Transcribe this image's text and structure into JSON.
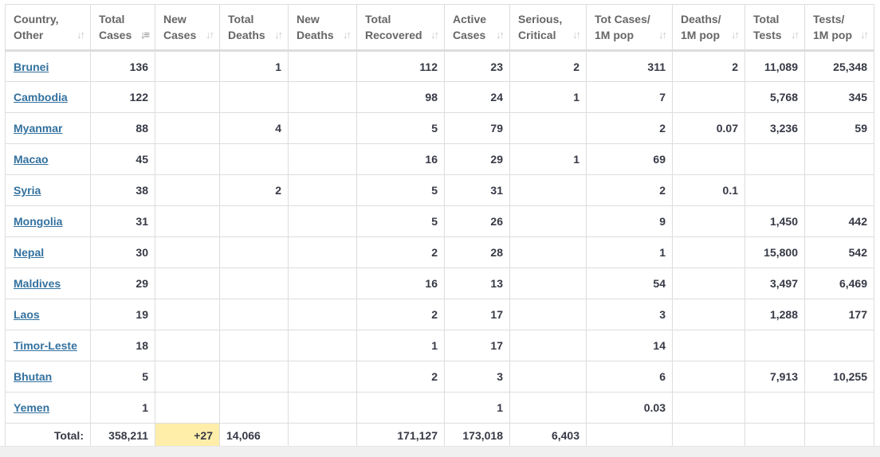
{
  "table": {
    "headers": [
      {
        "label": "Country,\nOther",
        "key": "country",
        "sort": "inactive"
      },
      {
        "label": "Total\nCases",
        "key": "total_cases",
        "sort": "active"
      },
      {
        "label": "New\nCases",
        "key": "new_cases",
        "sort": "inactive"
      },
      {
        "label": "Total\nDeaths",
        "key": "total_deaths",
        "sort": "inactive"
      },
      {
        "label": "New\nDeaths",
        "key": "new_deaths",
        "sort": "inactive"
      },
      {
        "label": "Total\nRecovered",
        "key": "total_recovered",
        "sort": "inactive"
      },
      {
        "label": "Active\nCases",
        "key": "active_cases",
        "sort": "inactive"
      },
      {
        "label": "Serious,\nCritical",
        "key": "serious",
        "sort": "inactive"
      },
      {
        "label": "Tot Cases/\n1M pop",
        "key": "cases_per_m",
        "sort": "inactive"
      },
      {
        "label": "Deaths/\n1M pop",
        "key": "deaths_per_m",
        "sort": "inactive"
      },
      {
        "label": "Total\nTests",
        "key": "total_tests",
        "sort": "inactive"
      },
      {
        "label": "Tests/\n1M pop",
        "key": "tests_per_m",
        "sort": "inactive"
      }
    ],
    "sort_icon_inactive": "↓↑",
    "sort_icon_active": "↓≡",
    "rows": [
      [
        "Brunei",
        "136",
        "",
        "1",
        "",
        "112",
        "23",
        "2",
        "311",
        "2",
        "11,089",
        "25,348"
      ],
      [
        "Cambodia",
        "122",
        "",
        "",
        "",
        "98",
        "24",
        "1",
        "7",
        "",
        "5,768",
        "345"
      ],
      [
        "Myanmar",
        "88",
        "",
        "4",
        "",
        "5",
        "79",
        "",
        "2",
        "0.07",
        "3,236",
        "59"
      ],
      [
        "Macao",
        "45",
        "",
        "",
        "",
        "16",
        "29",
        "1",
        "69",
        "",
        "",
        ""
      ],
      [
        "Syria",
        "38",
        "",
        "2",
        "",
        "5",
        "31",
        "",
        "2",
        "0.1",
        "",
        ""
      ],
      [
        "Mongolia",
        "31",
        "",
        "",
        "",
        "5",
        "26",
        "",
        "9",
        "",
        "1,450",
        "442"
      ],
      [
        "Nepal",
        "30",
        "",
        "",
        "",
        "2",
        "28",
        "",
        "1",
        "",
        "15,800",
        "542"
      ],
      [
        "Maldives",
        "29",
        "",
        "",
        "",
        "16",
        "13",
        "",
        "54",
        "",
        "3,497",
        "6,469"
      ],
      [
        "Laos",
        "19",
        "",
        "",
        "",
        "2",
        "17",
        "",
        "3",
        "",
        "1,288",
        "177"
      ],
      [
        "Timor-Leste",
        "18",
        "",
        "",
        "",
        "1",
        "17",
        "",
        "14",
        "",
        "",
        ""
      ],
      [
        "Bhutan",
        "5",
        "",
        "",
        "",
        "2",
        "3",
        "",
        "6",
        "",
        "7,913",
        "10,255"
      ],
      [
        "Yemen",
        "1",
        "",
        "",
        "",
        "",
        "1",
        "",
        "0.03",
        "",
        "",
        ""
      ]
    ],
    "total": [
      "Total:",
      "358,211",
      "+27",
      "14,066",
      "",
      "171,127",
      "173,018",
      "6,403",
      "",
      "",
      "",
      ""
    ]
  },
  "colors": {
    "link": "#33719f",
    "new_cases_highlight": "#ffeeaa",
    "text": "#363945",
    "header_text": "#666666",
    "border": "#dddddd"
  }
}
